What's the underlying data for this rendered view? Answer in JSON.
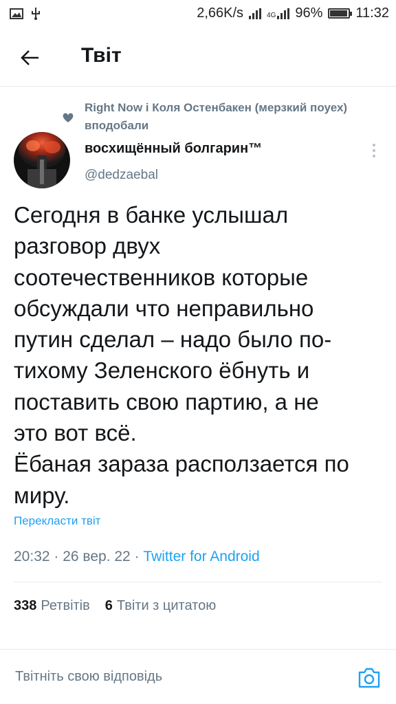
{
  "status_bar": {
    "speed": "2,66K/s",
    "network": "4G",
    "battery": "96%",
    "battery_level": 0.96,
    "time": "11:32"
  },
  "header": {
    "title": "Твіт"
  },
  "liked_by": "Right Now і Коля Остенбакен (мерзкий поуех) вподобали",
  "author": {
    "display_name": "восхищённый болгарин™",
    "handle": "@dedzaebal"
  },
  "tweet": {
    "text": "Сегодня в банке услышал\nразговор двух\nсоотечественников которые\nобсуждали что неправильно\nпутин сделал – надо было по-\nтихому Зеленского ёбнуть и\nпоставить свою партию, а не\nэто вот всё.\nЁбаная зараза расползается по\nмиру.",
    "translate_label": "Перекласти твіт",
    "time": "20:32",
    "date": "26 вер. 22",
    "source": "Twitter for Android"
  },
  "stats": {
    "retweets_count": "338",
    "retweets_label": "Ретвітів",
    "quotes_count": "6",
    "quotes_label": "Твіти з цитатою"
  },
  "reply": {
    "placeholder": "Твітніть свою відповідь"
  },
  "colors": {
    "accent": "#1da1f2",
    "secondary_text": "#657786",
    "divider": "#e6ecf0"
  }
}
